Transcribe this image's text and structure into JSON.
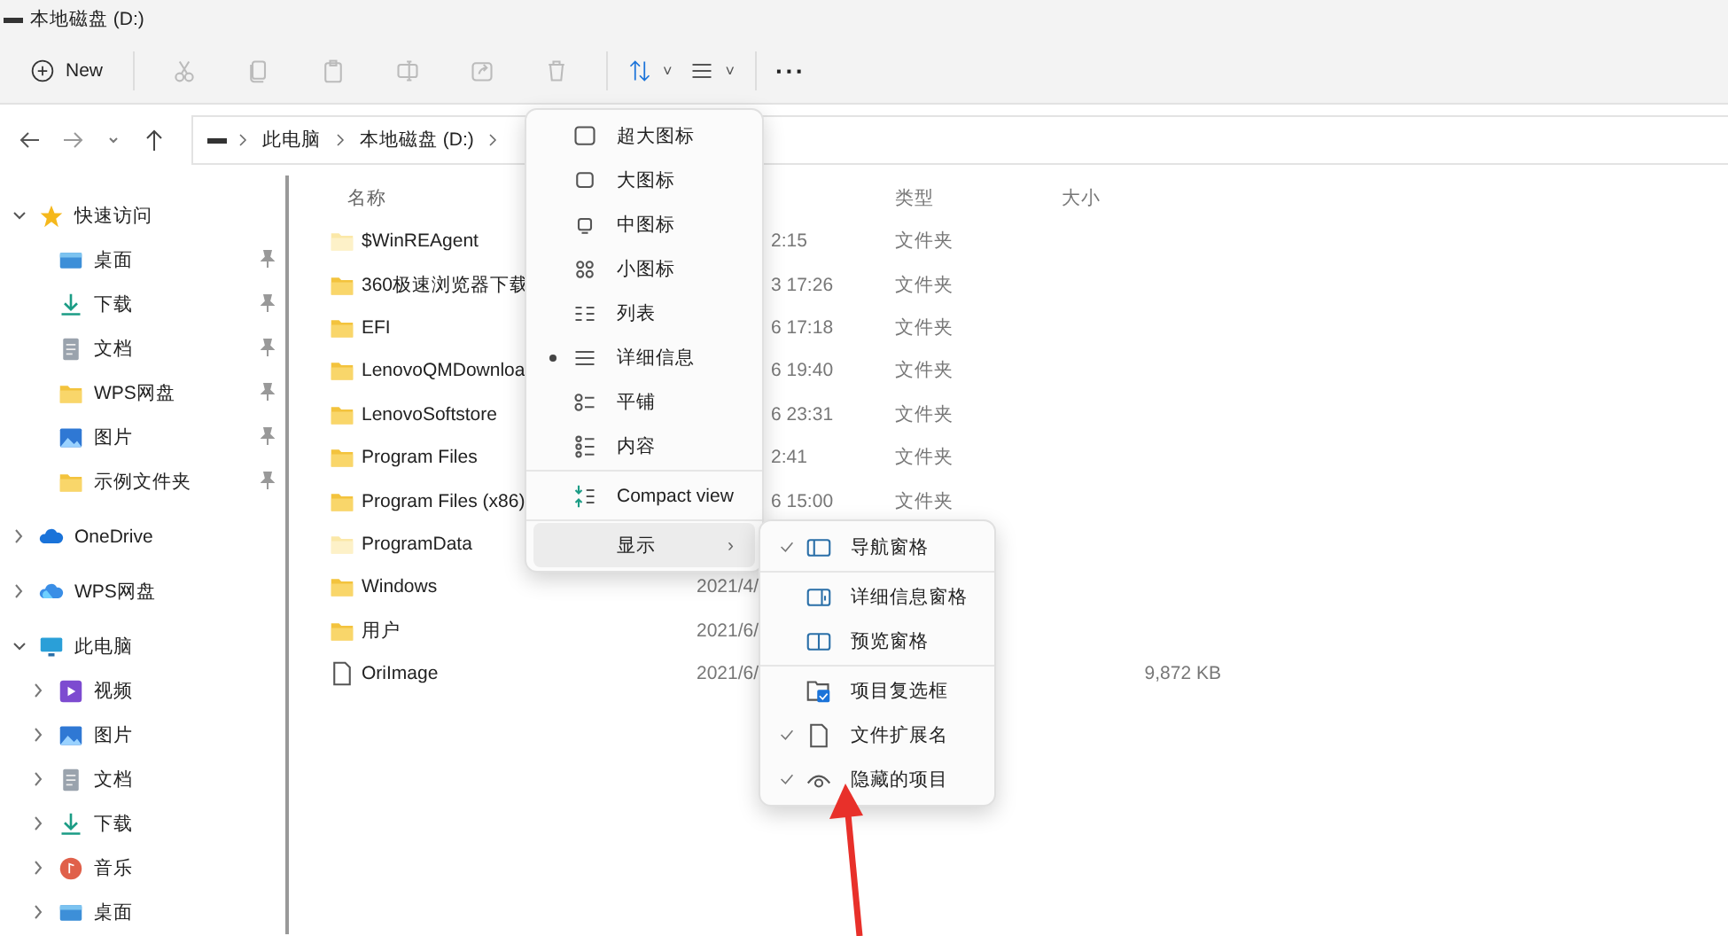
{
  "window": {
    "title": "本地磁盘 (D:)"
  },
  "toolbar": {
    "new_label": "New",
    "buttons": [
      {
        "kind": "cut",
        "disabled": true
      },
      {
        "kind": "copy",
        "disabled": true
      },
      {
        "kind": "paste",
        "disabled": true
      },
      {
        "kind": "rename",
        "disabled": true
      },
      {
        "kind": "share",
        "disabled": true
      },
      {
        "kind": "delete",
        "disabled": true
      }
    ],
    "sort_caret": "˅",
    "view_caret": "˅",
    "more": "···"
  },
  "address": {
    "path": [
      "此电脑",
      "本地磁盘 (D:)"
    ]
  },
  "nav": [
    {
      "label": "快速访问",
      "kind": "star",
      "expanded": true,
      "children": [
        {
          "label": "桌面",
          "kind": "desktop",
          "pinned": true
        },
        {
          "label": "下载",
          "kind": "download",
          "pinned": true
        },
        {
          "label": "文档",
          "kind": "document",
          "pinned": true
        },
        {
          "label": "WPS网盘",
          "kind": "folder",
          "pinned": true
        },
        {
          "label": "图片",
          "kind": "picture",
          "pinned": true
        },
        {
          "label": "示例文件夹",
          "kind": "folder",
          "pinned": true
        }
      ]
    },
    {
      "label": "OneDrive",
      "kind": "cloud",
      "expanded": false
    },
    {
      "label": "WPS网盘",
      "kind": "wps-cloud",
      "expanded": false
    },
    {
      "label": "此电脑",
      "kind": "pc",
      "expanded": true,
      "children": [
        {
          "label": "视频",
          "kind": "video",
          "expanded": false
        },
        {
          "label": "图片",
          "kind": "picture",
          "expanded": false
        },
        {
          "label": "文档",
          "kind": "document",
          "expanded": false
        },
        {
          "label": "下载",
          "kind": "download",
          "expanded": false
        },
        {
          "label": "音乐",
          "kind": "music",
          "expanded": false
        },
        {
          "label": "桌面",
          "kind": "desktop",
          "expanded": false
        }
      ]
    }
  ],
  "file_list": {
    "columns": [
      {
        "label": "名称"
      },
      {
        "label": "类型"
      },
      {
        "label": "大小"
      }
    ],
    "rows": [
      {
        "name": "$WinREAgent",
        "kind": "folder",
        "hidden": true,
        "date": "2:15",
        "type": "文件夹"
      },
      {
        "name": "360极速浏览器下载",
        "kind": "folder",
        "hidden": false,
        "date": "3 17:26",
        "type": "文件夹"
      },
      {
        "name": "EFI",
        "kind": "folder",
        "hidden": false,
        "date": "6 17:18",
        "type": "文件夹"
      },
      {
        "name": "LenovoQMDownloa",
        "kind": "folder",
        "hidden": false,
        "date": "6 19:40",
        "type": "文件夹"
      },
      {
        "name": "LenovoSoftstore",
        "kind": "folder",
        "hidden": false,
        "date": "6 23:31",
        "type": "文件夹"
      },
      {
        "name": "Program Files",
        "kind": "folder",
        "hidden": false,
        "date": "2:41",
        "type": "文件夹"
      },
      {
        "name": "Program Files (x86)",
        "kind": "folder",
        "hidden": false,
        "date": "6 15:00",
        "type": "文件夹"
      },
      {
        "name": "ProgramData",
        "kind": "folder",
        "hidden": true
      },
      {
        "name": "Windows",
        "kind": "folder",
        "hidden": false,
        "date": "2021/4/"
      },
      {
        "name": "用户",
        "kind": "folder",
        "hidden": false,
        "date": "2021/6/"
      },
      {
        "name": "OriImage",
        "kind": "file",
        "date": "2021/6/",
        "size": "9,872 KB"
      }
    ]
  },
  "view_menu": {
    "groups": [
      [
        {
          "label": "超大图标",
          "kind": "xl",
          "selected": false
        },
        {
          "label": "大图标",
          "kind": "lg",
          "selected": false
        },
        {
          "label": "中图标",
          "kind": "md",
          "selected": false
        },
        {
          "label": "小图标",
          "kind": "sm",
          "selected": false
        },
        {
          "label": "列表",
          "kind": "list",
          "selected": false
        },
        {
          "label": "详细信息",
          "kind": "details",
          "selected": true
        },
        {
          "label": "平铺",
          "kind": "tiles",
          "selected": false
        },
        {
          "label": "内容",
          "kind": "content",
          "selected": false
        }
      ],
      [
        {
          "label": "Compact view",
          "kind": "compact",
          "selected": false
        }
      ],
      [
        {
          "label": "显示",
          "kind": "submenu",
          "highlighted": true,
          "submenu": "›"
        }
      ]
    ]
  },
  "show_menu": {
    "groups": [
      [
        {
          "label": "导航窗格",
          "kind": "nav-pane",
          "checked": true
        }
      ],
      [
        {
          "label": "详细信息窗格",
          "kind": "details-pane",
          "checked": false
        },
        {
          "label": "预览窗格",
          "kind": "preview-pane",
          "checked": false
        }
      ],
      [
        {
          "label": "项目复选框",
          "kind": "checkbox",
          "checked": false
        },
        {
          "label": "文件扩展名",
          "kind": "file",
          "checked": true
        },
        {
          "label": "隐藏的项目",
          "kind": "eye",
          "checked": true
        }
      ]
    ]
  }
}
